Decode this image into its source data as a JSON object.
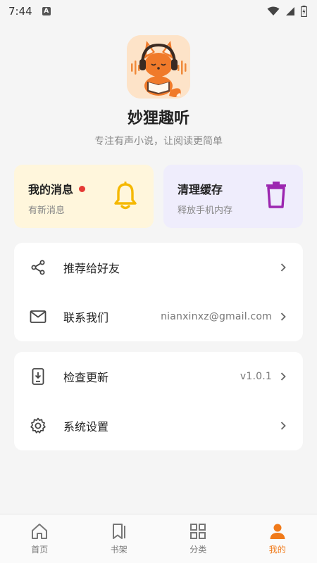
{
  "status": {
    "time": "7:44",
    "notif": "A"
  },
  "app": {
    "name": "妙狸趣听",
    "slogan": "专注有声小说，让阅读更简单"
  },
  "cards": {
    "messages": {
      "title": "我的消息",
      "subtitle": "有新消息",
      "icon": "bell-icon",
      "color": "#f5b800"
    },
    "cache": {
      "title": "清理缓存",
      "subtitle": "释放手机内存",
      "icon": "trash-icon",
      "color": "#9c27b0"
    }
  },
  "menu": {
    "share": {
      "label": "推荐给好友",
      "icon": "share-icon"
    },
    "contact": {
      "label": "联系我们",
      "value": "nianxinxz@gmail.com",
      "icon": "mail-icon"
    },
    "update": {
      "label": "检查更新",
      "value": "v1.0.1",
      "icon": "phone-download-icon"
    },
    "settings": {
      "label": "系统设置",
      "icon": "gear-icon"
    }
  },
  "tabs": [
    {
      "label": "首页",
      "icon": "home-icon"
    },
    {
      "label": "书架",
      "icon": "bookmark-icon"
    },
    {
      "label": "分类",
      "icon": "grid-icon"
    },
    {
      "label": "我的",
      "icon": "person-icon",
      "active": true
    }
  ],
  "colors": {
    "accent": "#f07a1a",
    "tab_inactive": "#777777"
  }
}
